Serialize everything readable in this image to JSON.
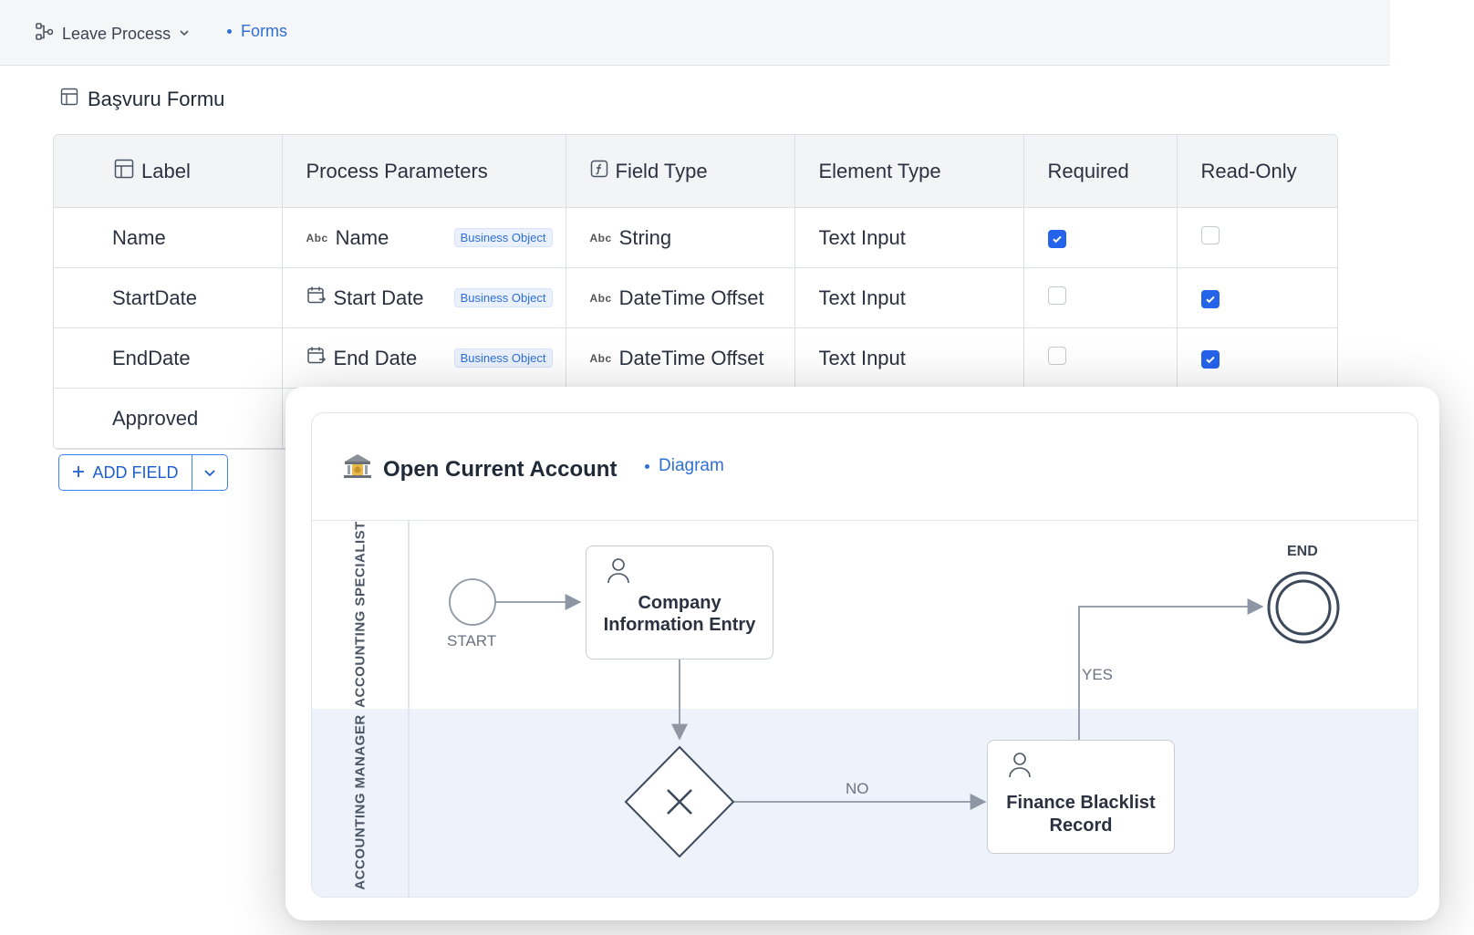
{
  "header": {
    "process_name": "Leave Process",
    "breadcrumb": "Forms"
  },
  "form": {
    "title": "Başvuru Formu",
    "columns": [
      "Label",
      "Process Parameters",
      "Field Type",
      "Element Type",
      "Required",
      "Read-Only"
    ],
    "rows": [
      {
        "label": "Name",
        "param": "Name",
        "param_icon": "abc-icon",
        "badge": "Business Object",
        "field_type": "String",
        "element_type": "Text Input",
        "required": true,
        "read_only": false
      },
      {
        "label": "StartDate",
        "param": "Start Date",
        "param_icon": "calendar-icon",
        "badge": "Business Object",
        "field_type": "DateTime Offset",
        "element_type": "Text Input",
        "required": false,
        "read_only": true
      },
      {
        "label": "EndDate",
        "param": "End Date",
        "param_icon": "calendar-icon",
        "badge": "Business Object",
        "field_type": "DateTime Offset",
        "element_type": "Text Input",
        "required": false,
        "read_only": true
      },
      {
        "label": "Approved"
      }
    ],
    "type_prefix": "Abc",
    "add_field_label": "ADD FIELD"
  },
  "diagram": {
    "title": "Open Current Account",
    "tag": "Diagram",
    "lanes": [
      "ACCOUNTING SPECIALIST",
      "ACCOUNTING MANAGER"
    ],
    "start_label": "START",
    "end_label": "END",
    "task1": "Company Information Entry",
    "task2": "Finance Blacklist Record",
    "yes_label": "YES",
    "no_label": "NO"
  },
  "colors": {
    "accent": "#2563eb",
    "lane_bg": "#edf2fb",
    "node_stroke": "#3d4a5c"
  }
}
